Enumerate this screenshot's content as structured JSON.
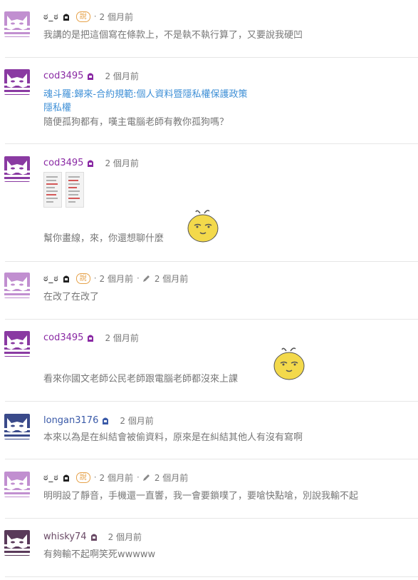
{
  "colors": {
    "avatar_bg": "#c18fd0",
    "avatar_mask": "#ffffff",
    "link": "#3e8fd6",
    "tag": "#e6a24a",
    "sticker": "#f3d94b"
  },
  "comments": [
    {
      "author": "ಠ_ಠ",
      "tag": "說",
      "time": "2 個月前",
      "lines": [
        "我講的是把這個寫在條款上，不是執不執行算了，又要說我硬凹"
      ]
    },
    {
      "author": "cod3495",
      "time": "2 個月前",
      "links": [
        "魂斗羅:歸來-合約規範:個人資料暨隱私權保護政策",
        "隱私權"
      ],
      "lines": [
        "隨便孤狗都有，嘆主電腦老師有教你孤狗嗎？"
      ]
    },
    {
      "author": "cod3495",
      "time": "2 個月前",
      "lines": [
        "幫你畫線，來，你還想聊什麼"
      ]
    },
    {
      "author": "ಠ_ಠ",
      "tag": "說",
      "time": "2 個月前",
      "edited_time": "2 個月前",
      "lines": [
        "在改了在改了"
      ]
    },
    {
      "author": "cod3495",
      "time": "2 個月前",
      "lines": [
        "看來你國文老師公民老師跟電腦老師都沒來上課"
      ]
    },
    {
      "author": "longan3176",
      "time": "2 個月前",
      "lines": [
        "本來以為是在糾結會被偷資料，原來是在糾結其他人有沒有寫啊"
      ]
    },
    {
      "author": "ಠ_ಠ",
      "tag": "說",
      "time": "2 個月前",
      "edited_time": "2 個月前",
      "lines": [
        "明明設了靜音，手機還一直響，我一會要鎖噗了，要嗆快點嗆，別說我輸不起"
      ]
    },
    {
      "author": "whisky74",
      "time": "2 個月前",
      "lines": [
        "有夠輸不起啊笑死wwwww"
      ]
    }
  ]
}
